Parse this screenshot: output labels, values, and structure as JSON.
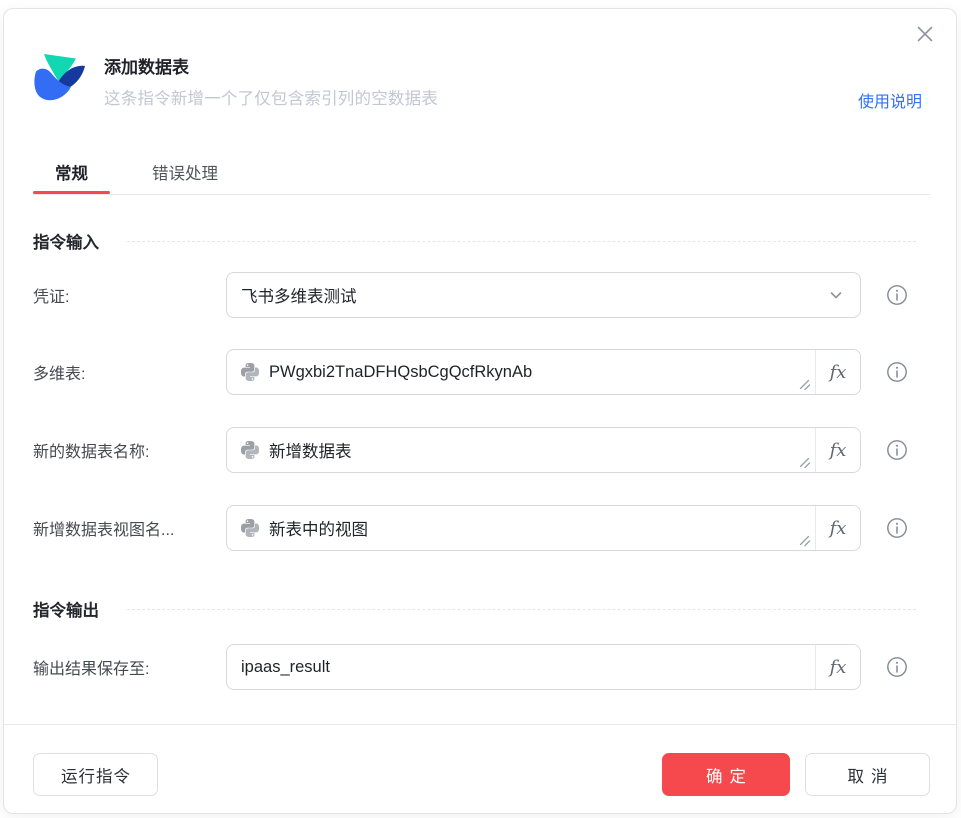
{
  "header": {
    "title": "添加数据表",
    "subtitle": "这条指令新增一个了仅包含索引列的空数据表",
    "help_link": "使用说明"
  },
  "tabs": {
    "general": "常规",
    "error_handling": "错误处理"
  },
  "input_section": {
    "heading": "指令输入",
    "fields": {
      "credential": {
        "label": "凭证:",
        "value": "飞书多维表测试"
      },
      "bitable": {
        "label": "多维表:",
        "value": "PWgxbi2TnaDFHQsbCgQcfRkynAb"
      },
      "table_name": {
        "label": "新的数据表名称:",
        "value": "新增数据表"
      },
      "view_name": {
        "label": "新增数据表视图名...",
        "value": "新表中的视图"
      }
    }
  },
  "output_section": {
    "heading": "指令输出",
    "fields": {
      "output_var": {
        "label": "输出结果保存至:",
        "value": "ipaas_result"
      }
    }
  },
  "controls": {
    "fx_label": "fx"
  },
  "footer": {
    "run": "运行指令",
    "ok": "确定",
    "cancel": "取消"
  },
  "icons": {
    "logo": "bitable-logo",
    "close": "close-icon",
    "chevron": "chevron-down-icon",
    "python": "python-icon",
    "info": "info-icon",
    "resize": "resize-handle-icon"
  },
  "colors": {
    "accent_red": "#F5494D",
    "link_blue": "#3370FF",
    "logo_teal": "#11D7B2",
    "logo_blue": "#336DF4",
    "logo_navy": "#16399E"
  }
}
